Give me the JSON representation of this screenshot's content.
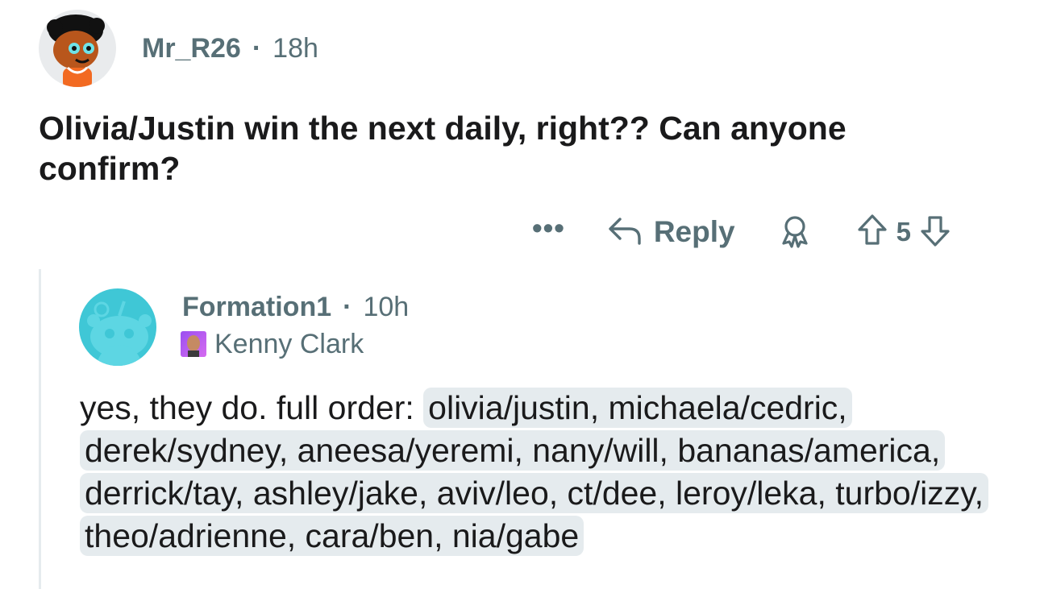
{
  "top_comment": {
    "username": "Mr_R26",
    "time": "18h",
    "body": "Olivia/Justin win the next daily, right?? Can anyone confirm?"
  },
  "actions": {
    "more_label": "•••",
    "reply_label": "Reply",
    "vote_count": "5"
  },
  "reply_comment": {
    "username": "Formation1",
    "time": "10h",
    "flair": "Kenny Clark",
    "body_plain": "yes, they do. full order: ",
    "body_highlighted": "olivia/justin, michaela/cedric, derek/sydney, aneesa/yeremi, nany/will, bananas/america, derrick/tay, ashley/jake, aviv/leo, ct/dee, leroy/leka, turbo/izzy, theo/adrienne, cara/ben, nia/gabe"
  },
  "colors": {
    "meta_gray": "#576f76",
    "text": "#1a1a1b",
    "highlight_bg": "#e5ebee",
    "thread_line": "#e5ebee",
    "reply_avatar_bg": "#3fc7d6",
    "user_avatar_orange": "#f26a22"
  },
  "icons": [
    "more-icon",
    "reply-arrow-icon",
    "award-icon",
    "upvote-icon",
    "downvote-icon"
  ]
}
